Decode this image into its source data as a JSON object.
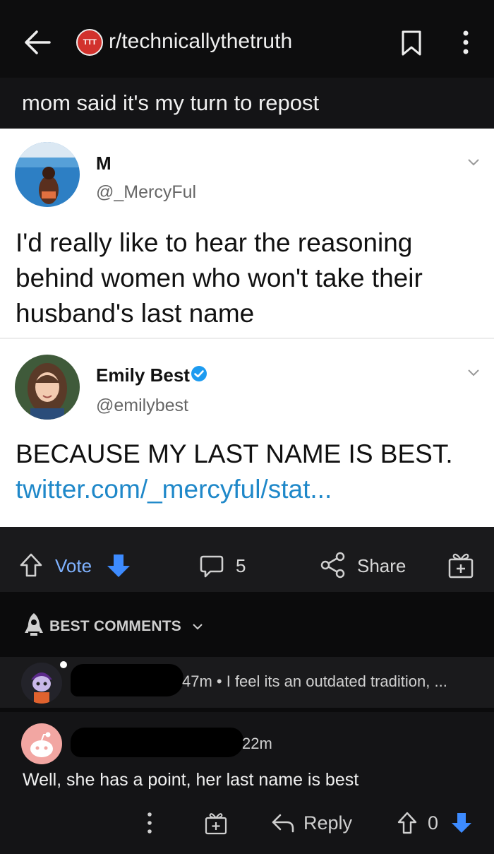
{
  "header": {
    "subreddit": "r/technicallythetruth",
    "subreddit_badge": "TTT",
    "icons": [
      "back-arrow-icon",
      "bookmark-icon",
      "more-vertical-icon"
    ]
  },
  "post": {
    "title": "mom said it's my turn to repost"
  },
  "tweet1": {
    "name": "M",
    "handle": "@_MercyFul",
    "lines": [
      "I'd really like to hear the reasoning",
      "behind women who won't take their",
      "husband's last name"
    ]
  },
  "tweet2": {
    "name": "Emily Best",
    "handle": "@emilybest",
    "body": "BECAUSE MY LAST NAME IS BEST.",
    "link": "twitter.com/_mercyful/stat..."
  },
  "actions": {
    "vote_label": "Vote",
    "comment_count": "5",
    "share_label": "Share"
  },
  "comments_header": {
    "sort_label": "BEST COMMENTS"
  },
  "comments": [
    {
      "meta": "47m • I feel its an outdated tradition, ..."
    },
    {
      "time": "22m",
      "body": "Well, she has a point, her last name is best",
      "reply_label": "Reply",
      "score": "0"
    }
  ],
  "colors": {
    "accent_blue": "#7fb2ff",
    "link_blue": "#1f88c9",
    "badge_red": "#d2322d",
    "verified_blue": "#1d9bf0"
  }
}
